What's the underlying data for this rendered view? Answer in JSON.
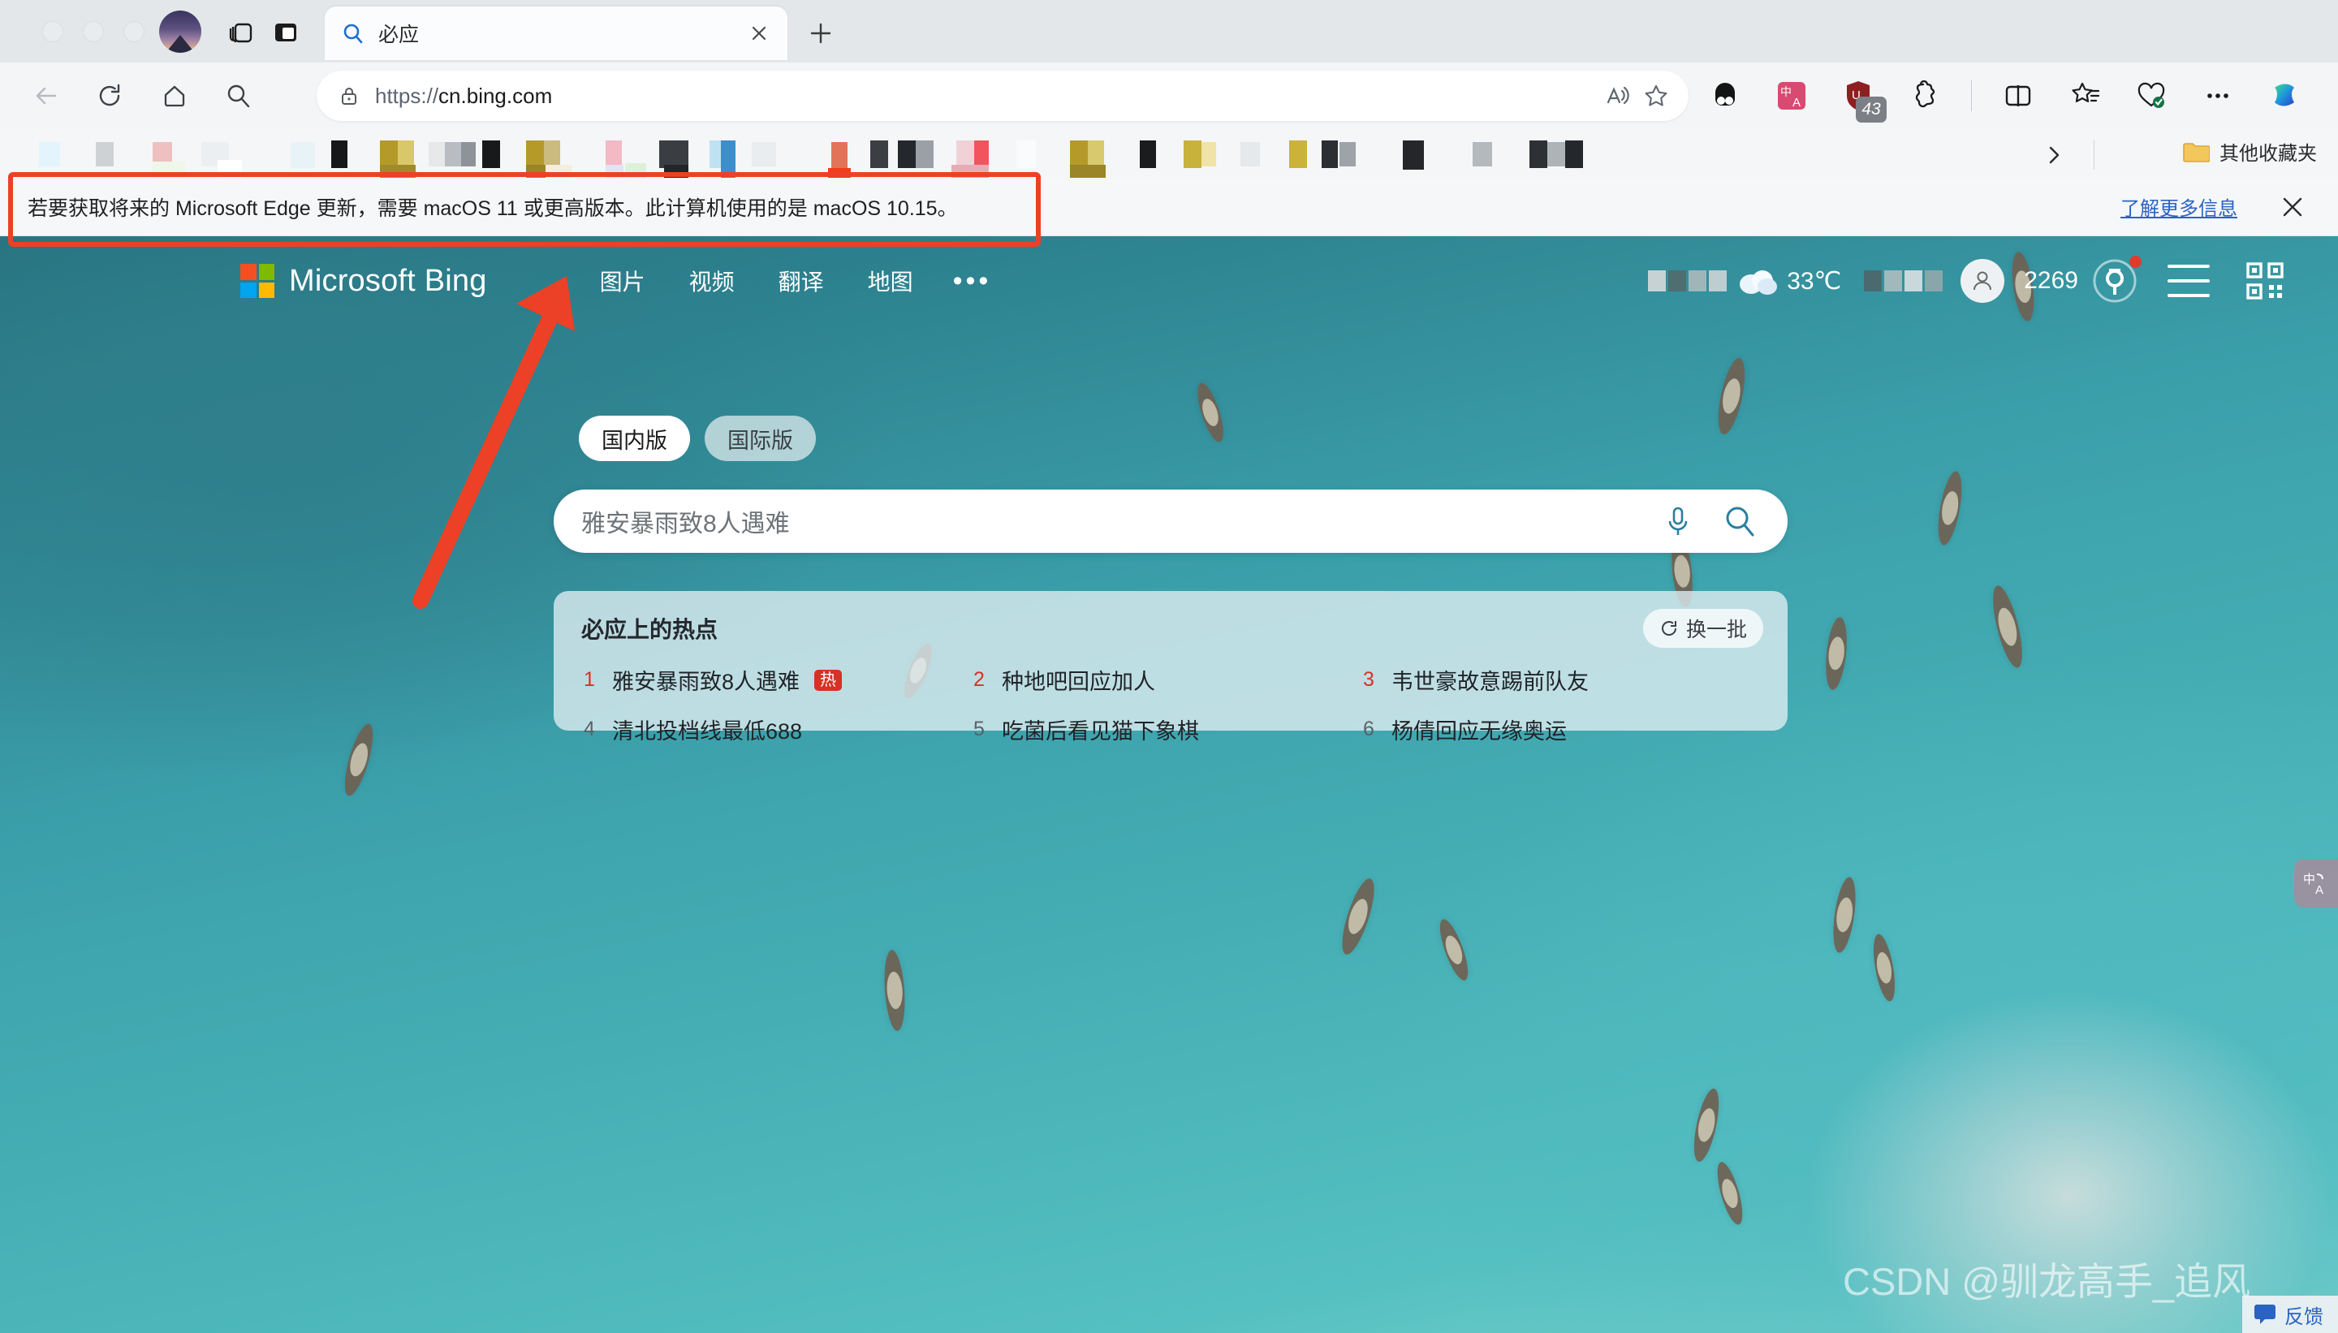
{
  "browser": {
    "window_controls": [
      "close",
      "minimize",
      "maximize"
    ],
    "profile_name": "profile-avatar",
    "tab": {
      "title": "必应",
      "favicon": "bing-search-icon",
      "close_label": "×"
    },
    "new_tab_label": "+",
    "nav": {
      "back": "back-arrow",
      "reload": "reload",
      "home": "home",
      "search": "search"
    },
    "address": {
      "scheme": "https://",
      "host": "cn.bing.com",
      "full": "https://cn.bing.com",
      "lock": "secure-lock-icon",
      "read_aloud": "read-aloud-icon",
      "favorite": "add-favorite-star-icon"
    },
    "toolbar_icons": [
      {
        "name": "extension-panda-icon",
        "badge": ""
      },
      {
        "name": "translate-extension-icon",
        "badge": ""
      },
      {
        "name": "shield-extension-icon",
        "badge": "43"
      },
      {
        "name": "puzzle-extensions-icon",
        "badge": ""
      },
      {
        "name": "split-screen-icon",
        "badge": ""
      },
      {
        "name": "favorites-icon",
        "badge": ""
      },
      {
        "name": "browser-essentials-icon",
        "badge": ""
      },
      {
        "name": "settings-more-icon",
        "badge": ""
      },
      {
        "name": "copilot-icon",
        "badge": ""
      }
    ],
    "bookmarks": {
      "chevron": "»",
      "other_favorites_label": "其他收藏夹",
      "folder_icon": "folder-icon"
    }
  },
  "banner": {
    "message": "若要获取将来的 Microsoft Edge 更新，需要 macOS 11 或更高版本。此计算机使用的是 macOS 10.15。",
    "link_label": "了解更多信息",
    "close_label": "×"
  },
  "bing": {
    "logo_text": "Microsoft Bing",
    "nav_items": [
      {
        "label": "图片"
      },
      {
        "label": "视频"
      },
      {
        "label": "翻译"
      },
      {
        "label": "地图"
      }
    ],
    "nav_more": "•••",
    "weather": {
      "icon": "partly-cloudy-icon",
      "temperature": "33℃",
      "location_masked": true
    },
    "account": {
      "icon": "person-icon",
      "points": "2269",
      "rewards_icon": "rewards-medal-icon",
      "notification_dot": true
    },
    "menu_icon": "hamburger-menu-icon",
    "qr_icon": "qr-code-icon",
    "region_toggle": {
      "options": [
        "国内版",
        "国际版"
      ],
      "selected": "国内版"
    },
    "search": {
      "value": "雅安暴雨致8人遇难",
      "placeholder": "雅安暴雨致8人遇难",
      "mic_icon": "microphone-icon",
      "search_icon": "search-icon"
    },
    "hot_panel": {
      "title": "必应上的热点",
      "refresh_label": "换一批",
      "refresh_icon": "refresh-icon",
      "items": [
        {
          "rank": "1",
          "text": "雅安暴雨致8人遇难",
          "badge": "热"
        },
        {
          "rank": "2",
          "text": "种地吧回应加人",
          "badge": ""
        },
        {
          "rank": "3",
          "text": "韦世豪故意踢前队友",
          "badge": ""
        },
        {
          "rank": "4",
          "text": "清北投档线最低688",
          "badge": ""
        },
        {
          "rank": "5",
          "text": "吃菌后看见猫下象棋",
          "badge": ""
        },
        {
          "rank": "6",
          "text": "杨倩回应无缘奥运",
          "badge": ""
        }
      ]
    },
    "translate_pill": {
      "icon": "translate-icon",
      "label": "中A"
    },
    "feedback": {
      "label": "反馈",
      "icon": "feedback-icon"
    }
  },
  "watermark": "CSDN @驯龙高手_追风",
  "colors": {
    "accent_red": "#ec4126",
    "hot_badge": "#d93025",
    "link_blue": "#2a63c4",
    "water_teal": "#3da3b0"
  }
}
